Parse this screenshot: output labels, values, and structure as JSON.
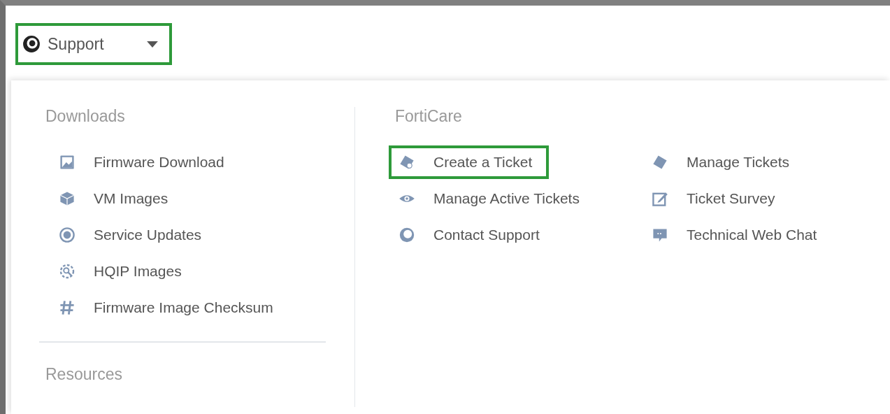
{
  "support_menu": {
    "label": "Support",
    "highlighted": true
  },
  "downloads": {
    "heading": "Downloads",
    "items": [
      {
        "label": "Firmware Download",
        "kind": "image",
        "highlighted": false
      },
      {
        "label": "VM Images",
        "kind": "cube",
        "highlighted": false
      },
      {
        "label": "Service Updates",
        "kind": "target",
        "highlighted": false
      },
      {
        "label": "HQIP Images",
        "kind": "gear-search",
        "highlighted": false
      },
      {
        "label": "Firmware Image Checksum",
        "kind": "hash",
        "highlighted": false
      }
    ]
  },
  "resources": {
    "heading": "Resources"
  },
  "forticare": {
    "heading": "FortiCare",
    "items": [
      {
        "label": "Create a Ticket",
        "kind": "ticket-plus",
        "highlighted": true
      },
      {
        "label": "Manage Tickets",
        "kind": "ticket",
        "highlighted": false
      },
      {
        "label": "Manage Active Tickets",
        "kind": "eye",
        "highlighted": false
      },
      {
        "label": "Ticket Survey",
        "kind": "edit",
        "highlighted": false
      },
      {
        "label": "Contact Support",
        "kind": "clock24",
        "highlighted": false
      },
      {
        "label": "Technical Web Chat",
        "kind": "chat",
        "highlighted": false
      }
    ]
  }
}
